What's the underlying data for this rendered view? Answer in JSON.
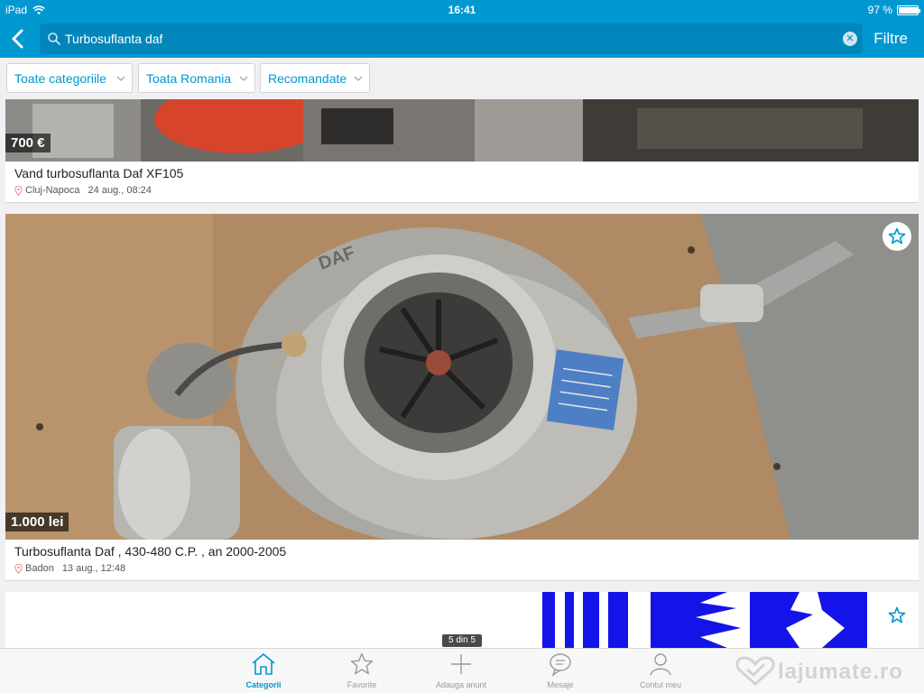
{
  "status": {
    "device": "iPad",
    "time": "16:41",
    "battery": "97 %",
    "battery_level": 0.97
  },
  "search": {
    "query": "Turbosuflanta daf",
    "filter_label": "Filtre"
  },
  "filters": [
    "Toate categoriile",
    "Toata Romania",
    "Recomandate"
  ],
  "listings": [
    {
      "price": "700 €",
      "title": "Vand turbosuflanta Daf XF105",
      "location": "Cluj-Napoca",
      "date": "24 aug., 08:24"
    },
    {
      "price": "1.000 lei",
      "title": "Turbosuflanta Daf , 430-480 C.P. , an 2000-2005",
      "location": "Badon",
      "date": "13 aug., 12:48"
    },
    {
      "price": "",
      "title": "",
      "location": "",
      "date": ""
    }
  ],
  "image_text": {
    "brand": "DAF"
  },
  "pager": "5 din 5",
  "tabs": [
    "Categorii",
    "Favorite",
    "Adauga anunt",
    "Mesaje",
    "Contul meu"
  ],
  "watermark": "lajumate.ro",
  "colors": {
    "accent": "#0098d0",
    "search_bg": "#0086bb"
  },
  "icons": [
    "wifi-icon",
    "back-chevron-icon",
    "search-icon",
    "clear-icon",
    "chevron-down-icon",
    "location-pin-icon",
    "star-icon",
    "home-icon",
    "plus-icon",
    "chat-icon",
    "user-icon"
  ]
}
